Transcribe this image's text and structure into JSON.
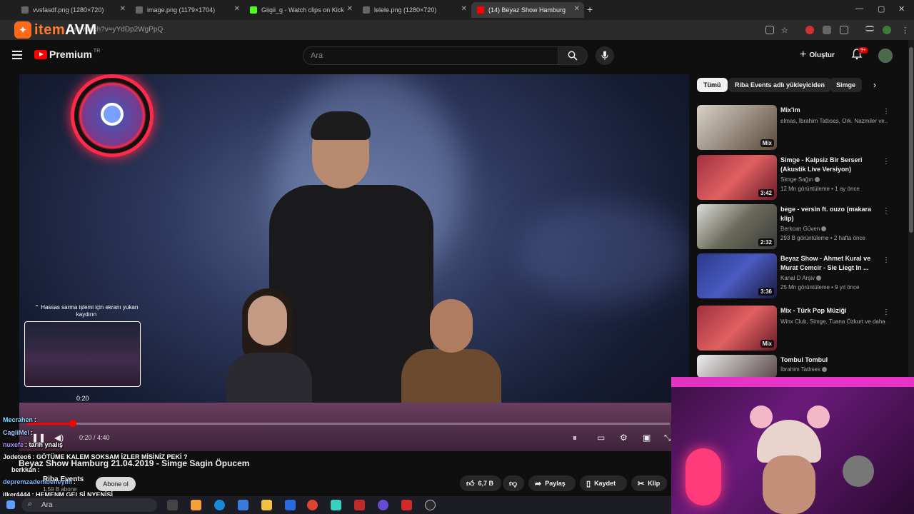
{
  "browser": {
    "tabs": [
      {
        "title": "vvsfasdf.png (1280×720)",
        "close": "✕"
      },
      {
        "title": "image.png (1179×1704)",
        "close": "✕"
      },
      {
        "title": "Giigii_g - Watch clips on Kick",
        "close": "✕"
      },
      {
        "title": "lelele.png (1280×720)",
        "close": "✕"
      },
      {
        "title": "(14) Beyaz Show Hamburg",
        "close": "✕"
      }
    ],
    "new_tab": "+",
    "url": "m/watch?v=yYdDp2WgPpQ",
    "window_controls": {
      "minimize": "—",
      "maximize": "▢",
      "close": "✕"
    }
  },
  "overlay_logo": {
    "icon": "controller-icon",
    "word_a": "item",
    "word_b": "AVM"
  },
  "header": {
    "logo_text": "Premium",
    "logo_region": "TR",
    "search_placeholder": "Ara",
    "create_label": "Oluştur",
    "notification_count": "9+"
  },
  "player": {
    "preview_hint": "Hassas sarma işlemi için ekranı yukarı kaydırın",
    "preview_time": "0:20",
    "time_display": "0:20 / 4:40",
    "progress_fraction": 0.071
  },
  "chat": [
    {
      "user": "Mecrahen",
      "text": ":"
    },
    {
      "user": "CagliMel",
      "text": ":"
    },
    {
      "user": "nuxefe",
      "text": ": tarih ynalış"
    },
    {
      "user": "Jodeteo6",
      "text": ": GÖTÜME KALEM SOKSAM İZLER MİSİNİZ PEKİ ?"
    },
    {
      "user": "berkkan",
      "text": ":"
    },
    {
      "user": "depremzadembeneyim",
      "text": ":"
    },
    {
      "user": "ilker4444",
      "text": ": HEMENM GELSİ NYENİSİ"
    }
  ],
  "video": {
    "title": "Beyaz Show Hamburg 21.04.2019 - Simge Sagin Öpucem",
    "channel": "Riba Events",
    "subscribers": "1,59 B abone",
    "subscribe_label": "Abone ol",
    "likes": "6,7 B",
    "share_label": "Paylaş",
    "save_label": "Kaydet",
    "clip_label": "Klip"
  },
  "sidebar": {
    "chips": [
      "Tümü",
      "Riba Events adlı yükleyiciden",
      "Simge"
    ],
    "recommendations": [
      {
        "title": "Mix'im",
        "meta1": "elmas, İbrahim Tatlıses, Ork. Nazmiler ve...",
        "meta2": "",
        "duration": "Mix"
      },
      {
        "title": "Simge - Kalpsiz Bir Serseri (Akustik Live Versiyon)",
        "meta1": "Simge Sağın",
        "meta2": "12 Mn görüntüleme • 1 ay önce",
        "duration": "3:42"
      },
      {
        "title": "bege - versin ft. ouzo (makara klip)",
        "meta1": "Berkcan Güven",
        "meta2": "293 B görüntüleme • 2 hafta önce",
        "duration": "2:32"
      },
      {
        "title": "Beyaz Show - Ahmet Kural ve Murat Cemcir - Sie Liegt In ...",
        "meta1": "Kanal D Arşiv",
        "meta2": "25 Mn görüntüleme • 9 yıl önce",
        "duration": "3:36"
      },
      {
        "title": "Mix - Türk Pop Müziği",
        "meta1": "Winx Club, Simge, Tuana Özkurt ve daha ...",
        "meta2": "",
        "duration": "Mix"
      },
      {
        "title": "Tombul Tombul",
        "meta1": "İbrahim Tatlıses",
        "meta2": "",
        "duration": ""
      }
    ]
  },
  "taskbar": {
    "search_placeholder": "Ara"
  },
  "colors": {
    "accent": "#ff0000",
    "background": "#0f0f0f",
    "overlay_orange": "#ff7a2a",
    "webcam_light": "#ff3ad8"
  }
}
